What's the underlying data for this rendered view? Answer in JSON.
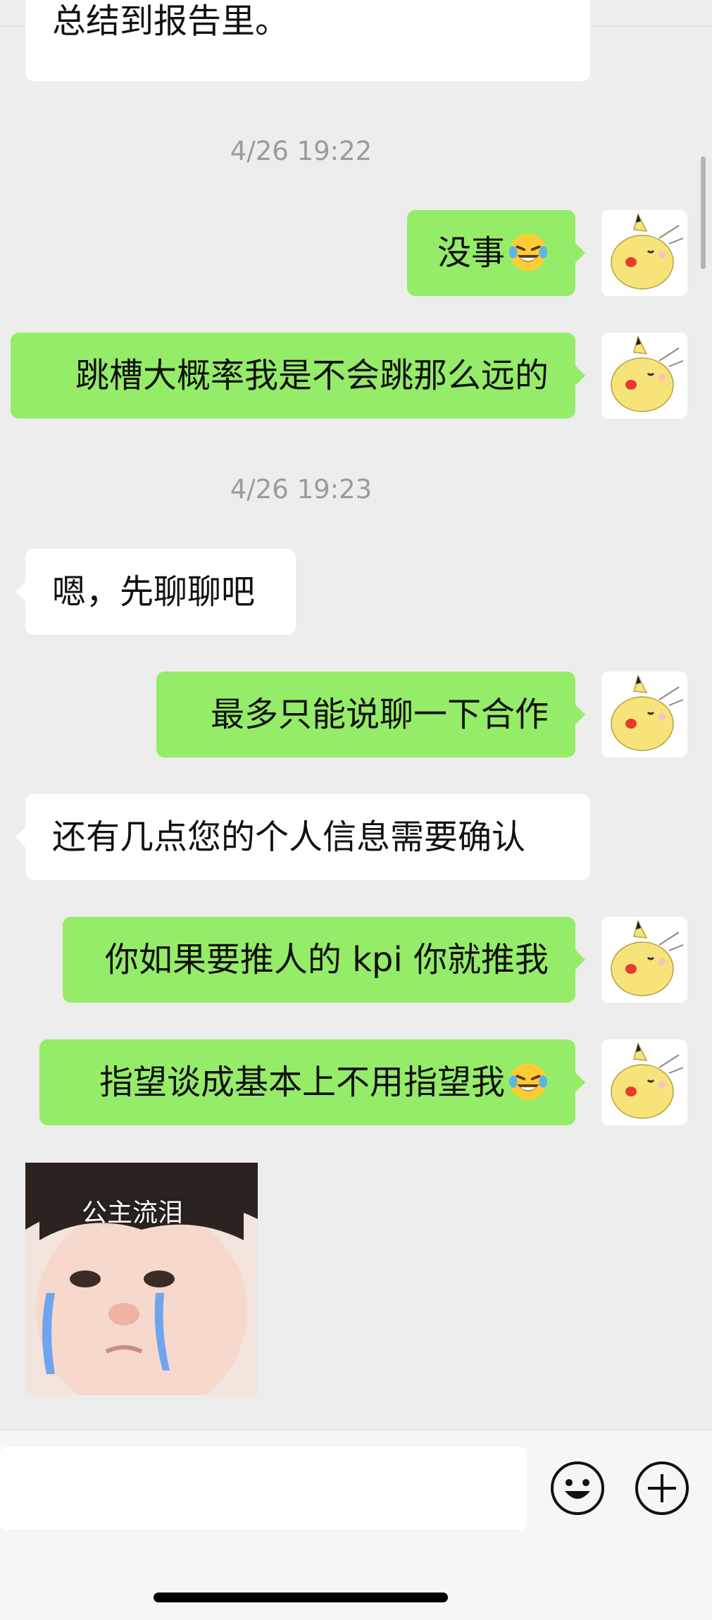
{
  "header": {
    "cut_message": "总结到报告里。"
  },
  "timestamps": [
    "4/26 19:22",
    "4/26 19:23"
  ],
  "messages": {
    "m1": "没事",
    "m2": "跳槽大概率我是不会跳那么远的",
    "m3": "嗯，先聊聊吧",
    "m4": "最多只能说聊一下合作",
    "m5": "还有几点您的个人信息需要确认",
    "m6": "你如果要推人的 kpi 你就推我",
    "m7": "指望谈成基本上不用指望我"
  },
  "sticker": {
    "caption": "公主流泪"
  },
  "input": {
    "placeholder": ""
  },
  "icons": {
    "emoji": "laughing-tears-emoji",
    "face": "smiley-face-icon",
    "plus": "plus-circle-icon"
  },
  "colors": {
    "outgoing_bubble": "#95ec69",
    "incoming_bubble": "#ffffff",
    "background": "#ededed"
  }
}
